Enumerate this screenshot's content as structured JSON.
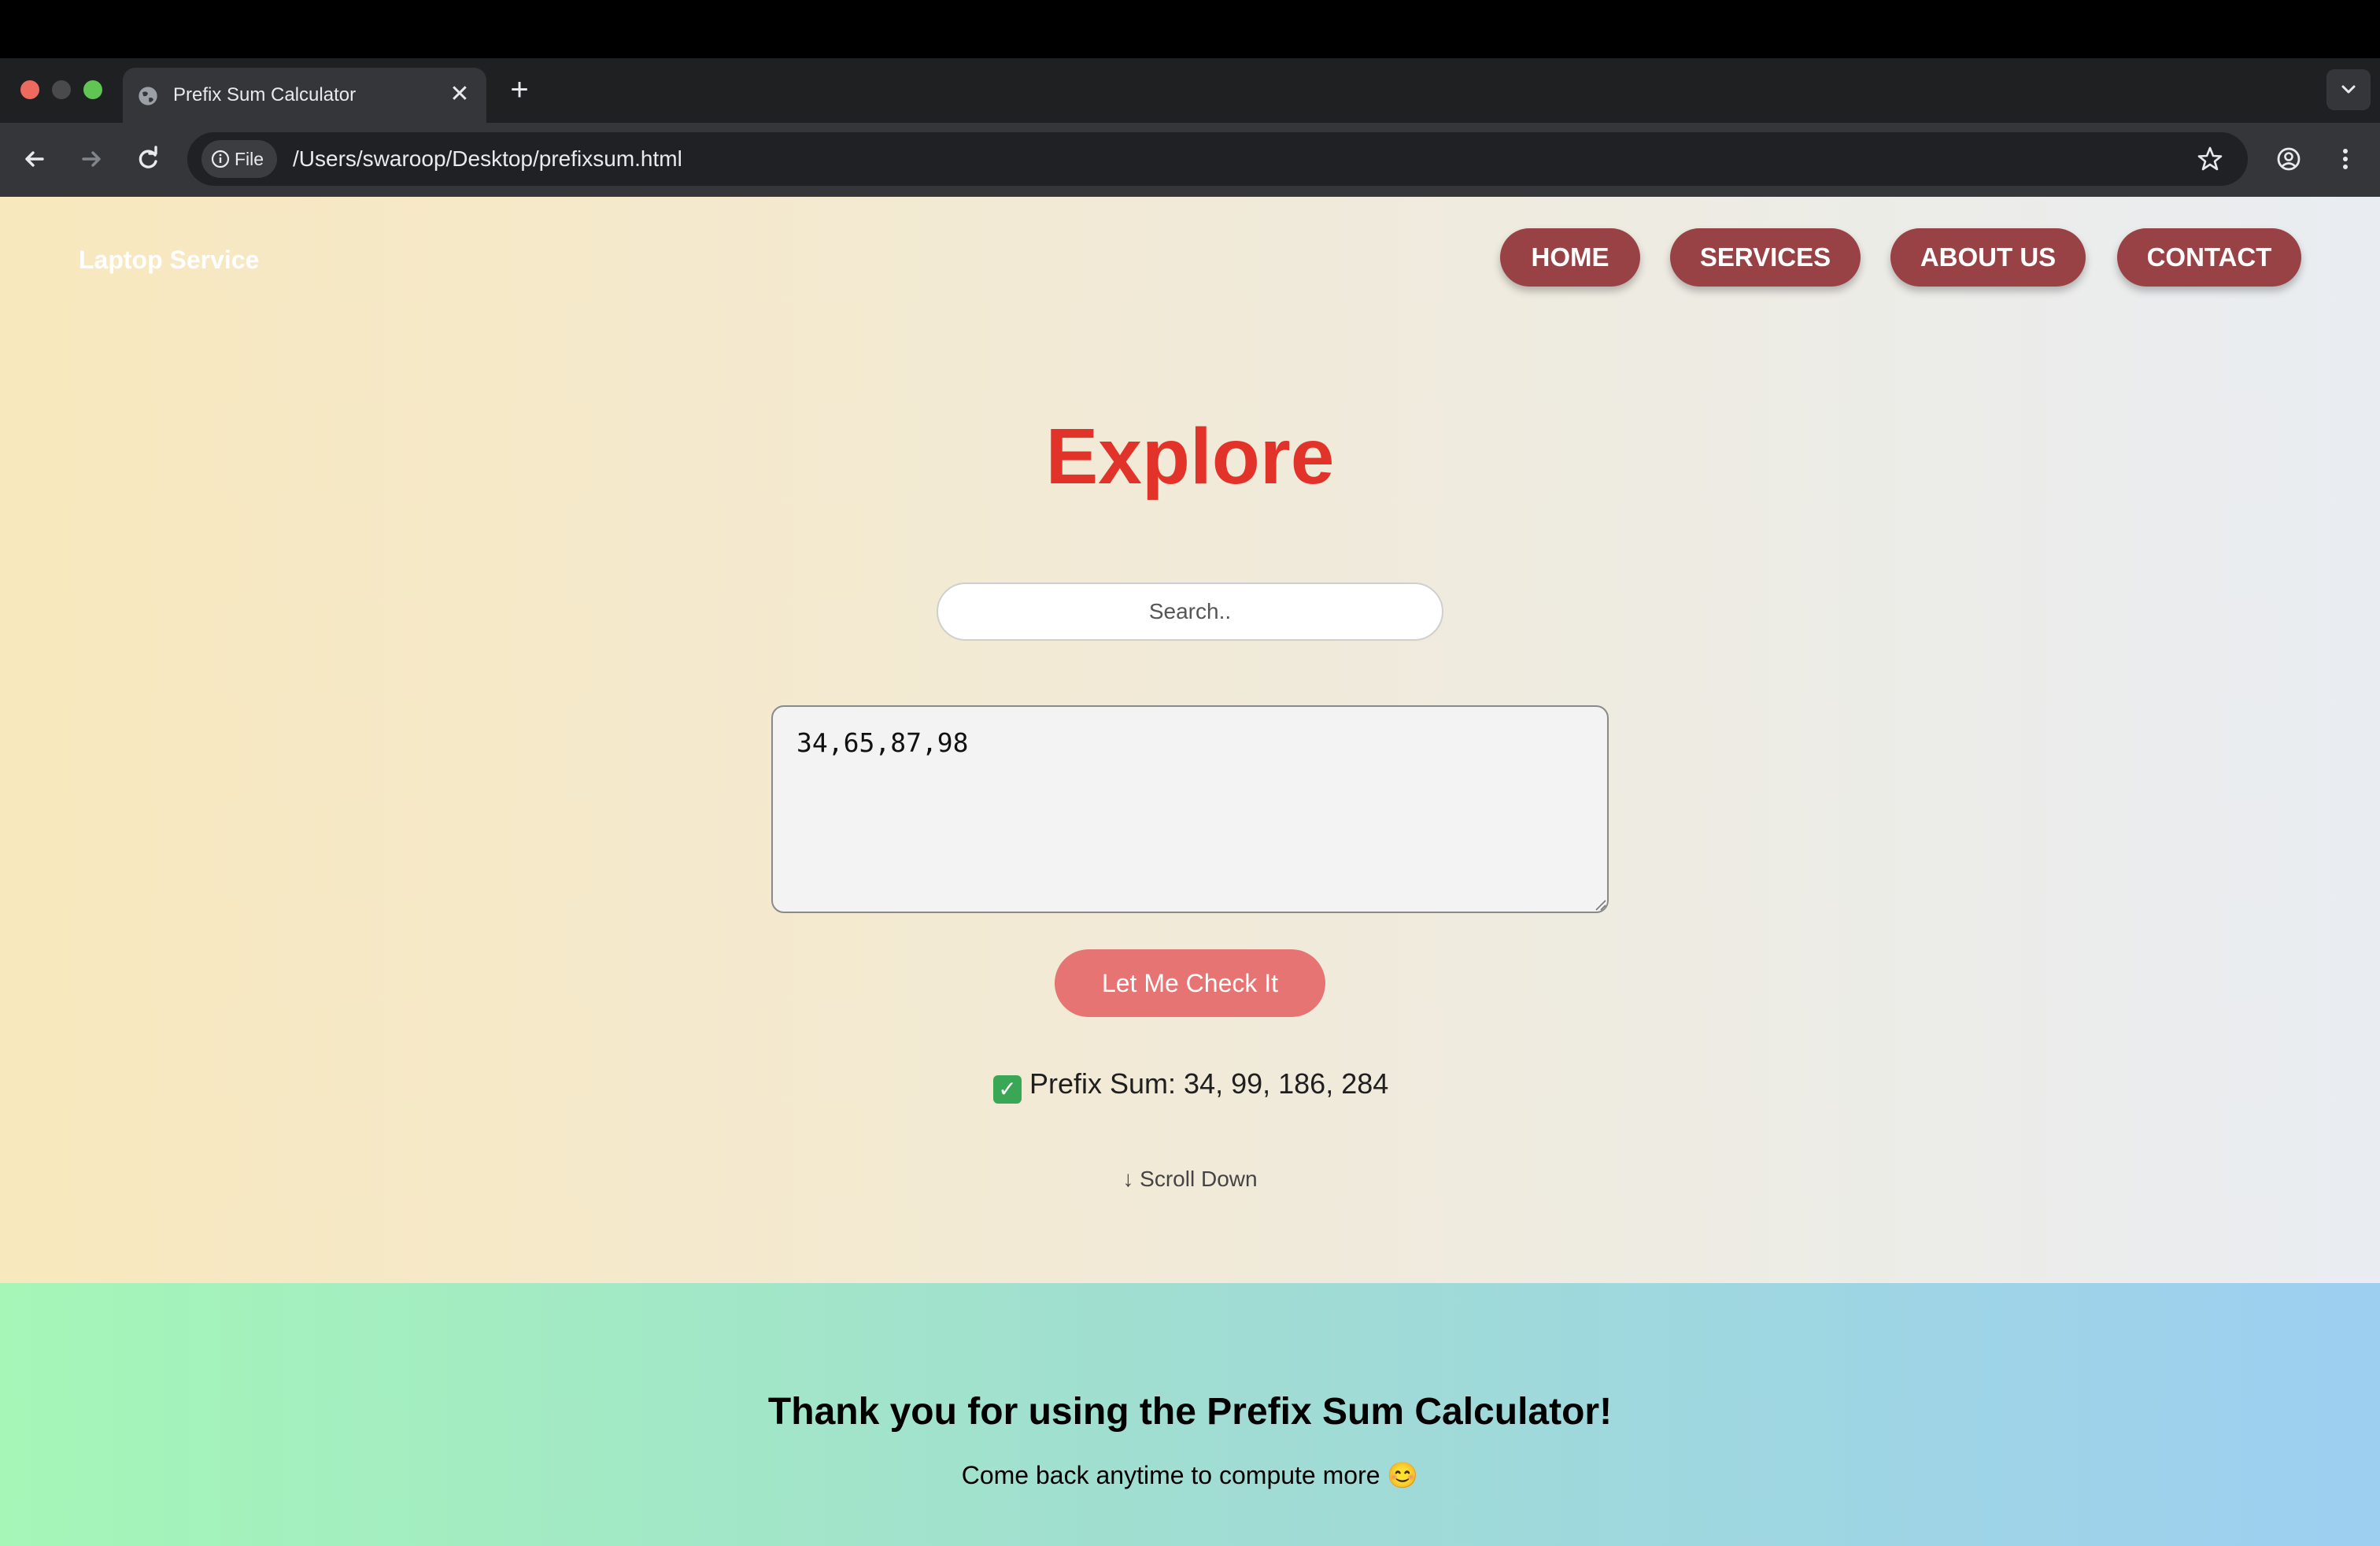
{
  "browser": {
    "tab_title": "Prefix Sum Calculator",
    "tab_close": "✕",
    "new_tab": "+",
    "address_chip": "File",
    "url": "/Users/swaroop/Desktop/prefixsum.html"
  },
  "page": {
    "brand": "Laptop Service",
    "nav": [
      "HOME",
      "SERVICES",
      "ABOUT US",
      "CONTACT"
    ],
    "title": "Explore",
    "search_placeholder": "Search..",
    "numbers_value": "34,65,87,98",
    "check_button": "Let Me Check It",
    "result_icon": "✓",
    "result": "Prefix Sum: 34, 99, 186, 284",
    "scroll_hint": "↓ Scroll Down"
  },
  "footer": {
    "title": "Thank you for using the Prefix Sum Calculator!",
    "text": "Come back anytime to compute more 😊"
  },
  "colors": {
    "accent_title": "#e1332a",
    "nav_pill": "#994245",
    "check_button": "#e67472"
  },
  "icons": [
    "globe-icon",
    "back-arrow-icon",
    "forward-arrow-icon",
    "reload-icon",
    "info-icon",
    "star-icon",
    "profile-icon",
    "kebab-menu-icon",
    "chevron-down-icon",
    "checkmark-icon"
  ]
}
